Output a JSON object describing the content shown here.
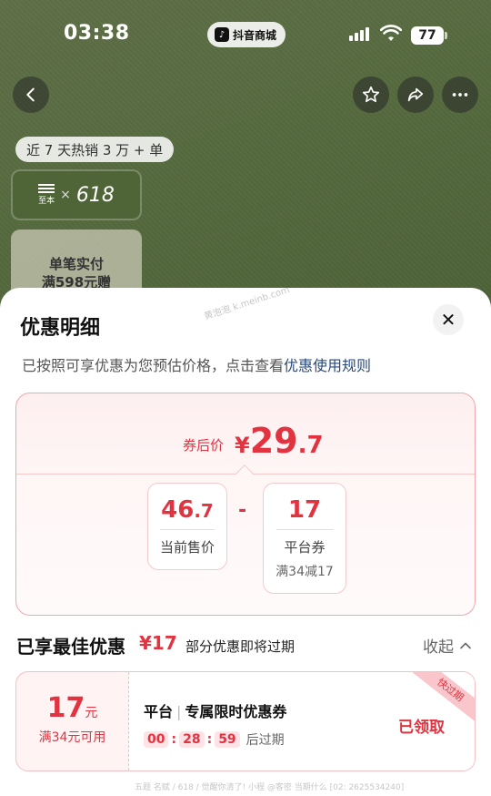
{
  "status_bar": {
    "time": "03:38",
    "app_pill": "抖音商城",
    "battery": "77"
  },
  "nav": {
    "back_icon": "chevron-left-icon",
    "favorite_icon": "star-icon",
    "share_icon": "share-arrow-icon",
    "more_icon": "ellipsis-icon"
  },
  "product": {
    "sales_pill": "近 7 天热销 3 万 + 单",
    "promo_brand": "至本",
    "promo_x": "×",
    "promo_num": "618",
    "promo_line1": "单笔实付",
    "promo_line2": "满598元赠"
  },
  "sheet": {
    "title": "优惠明细",
    "watermark": "黄泡泡 k.meinb.com",
    "desc_prefix": "已按照可享优惠为您预估价格，点击查看",
    "desc_link": "优惠使用规则",
    "close_icon": "close-icon"
  },
  "price_summary": {
    "after_label": "券后价",
    "currency": "¥",
    "after_int": "29",
    "after_dec": ".7",
    "current_int": "46",
    "current_dec": ".7",
    "current_label": "当前售价",
    "minus": "-",
    "platform_value": "17",
    "platform_label": "平台券",
    "platform_cond": "满34减17"
  },
  "best": {
    "title": "已享最佳优惠",
    "amount": "¥17",
    "note": "部分优惠即将过期",
    "collapse": "收起"
  },
  "coupon": {
    "amount": "17",
    "unit": "元",
    "condition": "满34元可用",
    "type": "平台",
    "name": "专属限时优惠券",
    "timer": [
      "00",
      "28",
      "59"
    ],
    "expire_suffix": "后过期",
    "status": "已领取",
    "ribbon": "快过期"
  },
  "footer_watermark": "五题 名赋 / 618 / 觉醒你清了! 小程 @客密 当期什么 [02: 2625534240]",
  "colors": {
    "accent": "#e13440",
    "product_bg": "#566a3f",
    "link": "#2a4a7a"
  }
}
